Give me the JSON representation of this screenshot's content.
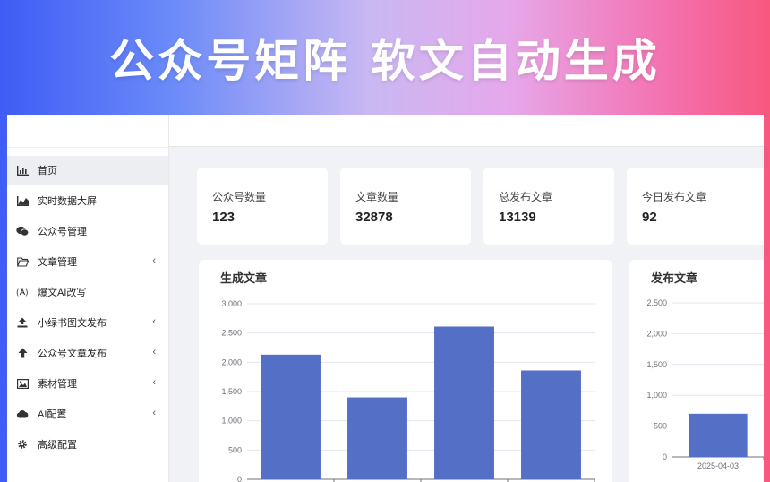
{
  "banner": {
    "title": "公众号矩阵  软文自动生成"
  },
  "sidebar": {
    "items": [
      {
        "label": "首页",
        "icon": "bar-chart-icon",
        "active": true,
        "submenu": false
      },
      {
        "label": "实时数据大屏",
        "icon": "area-chart-icon",
        "active": false,
        "submenu": false
      },
      {
        "label": "公众号管理",
        "icon": "wechat-icon",
        "active": false,
        "submenu": false
      },
      {
        "label": "文章管理",
        "icon": "folder-icon",
        "active": false,
        "submenu": true
      },
      {
        "label": "爆文AI改写",
        "icon": "ai-icon",
        "active": false,
        "submenu": false
      },
      {
        "label": "小绿书图文发布",
        "icon": "upload-icon",
        "active": false,
        "submenu": true
      },
      {
        "label": "公众号文章发布",
        "icon": "arrow-up-icon",
        "active": false,
        "submenu": true
      },
      {
        "label": "素材管理",
        "icon": "image-icon",
        "active": false,
        "submenu": true
      },
      {
        "label": "AI配置",
        "icon": "cloud-icon",
        "active": false,
        "submenu": true
      },
      {
        "label": "高级配置",
        "icon": "gear-icon",
        "active": false,
        "submenu": false
      }
    ]
  },
  "stats": [
    {
      "label": "公众号数量",
      "value": "123"
    },
    {
      "label": "文章数量",
      "value": "32878"
    },
    {
      "label": "总发布文章",
      "value": "13139"
    },
    {
      "label": "今日发布文章",
      "value": "92"
    }
  ],
  "colors": {
    "bar": "#5470c6",
    "grid": "#e0e6f1",
    "active_menu": "#eceef1"
  },
  "chart_data": [
    {
      "type": "bar",
      "title": "生成文章",
      "categories": [
        "",
        "",
        "",
        ""
      ],
      "values": [
        2130,
        1400,
        2610,
        1860
      ],
      "ylim": [
        0,
        3000
      ],
      "yticks": [
        "0",
        "500",
        "1,000",
        "1,500",
        "2,000",
        "2,500",
        "3,000"
      ],
      "grid": true
    },
    {
      "type": "bar",
      "title": "发布文章",
      "categories": [
        "2025-04-03"
      ],
      "values": [
        700
      ],
      "ylim": [
        0,
        2500
      ],
      "yticks": [
        "0",
        "500",
        "1,000",
        "1,500",
        "2,000",
        "2,500"
      ],
      "grid": true
    }
  ]
}
